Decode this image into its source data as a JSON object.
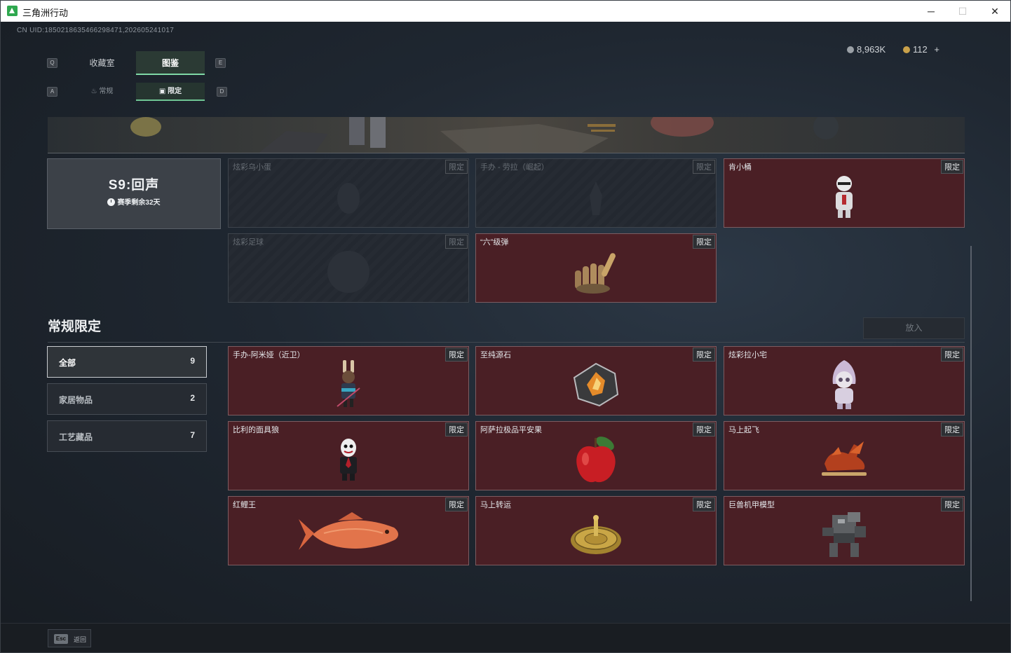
{
  "window": {
    "title": "三角洲行动",
    "min": "─",
    "max": "☐",
    "close": "✕"
  },
  "uid": "CN UID:1850218635466298471,202605241017",
  "keys": {
    "q": "Q",
    "e": "E",
    "a": "A",
    "d": "D"
  },
  "tabs": [
    {
      "label": "收藏室",
      "active": false
    },
    {
      "label": "图鉴",
      "active": true
    }
  ],
  "subtabs": [
    {
      "label": "常规",
      "active": false
    },
    {
      "label": "限定",
      "active": true
    }
  ],
  "currency": {
    "coins": "8,963K",
    "gold": "112",
    "add": "+"
  },
  "season": {
    "title": "S9:回声",
    "remaining": "赛季剩余32天"
  },
  "season_cards": [
    {
      "name": "炫彩乌小蛋",
      "tag": "限定",
      "owned": false
    },
    {
      "name": "手办 - 劳拉（崛起）",
      "tag": "限定",
      "owned": false
    },
    {
      "name": "肯小桶",
      "tag": "限定",
      "owned": true
    },
    {
      "name": "炫彩足球",
      "tag": "限定",
      "owned": false
    },
    {
      "name": "“六”级弹",
      "tag": "限定",
      "owned": true
    }
  ],
  "section": {
    "title": "常规限定",
    "put_in": "放入"
  },
  "filters": [
    {
      "label": "全部",
      "count": "9",
      "active": true
    },
    {
      "label": "家居物品",
      "count": "2",
      "active": false
    },
    {
      "label": "工艺藏品",
      "count": "7",
      "active": false
    }
  ],
  "items": [
    {
      "name": "手办-阿米娅（近卫）",
      "tag": "限定"
    },
    {
      "name": "至纯源石",
      "tag": "限定"
    },
    {
      "name": "炫彩拉小宅",
      "tag": "限定"
    },
    {
      "name": "比利的面具狼",
      "tag": "限定"
    },
    {
      "name": "阿萨拉极品平安果",
      "tag": "限定"
    },
    {
      "name": "马上起飞",
      "tag": "限定"
    },
    {
      "name": "红鲤王",
      "tag": "限定"
    },
    {
      "name": "马上转运",
      "tag": "限定"
    },
    {
      "name": "巨兽机甲模型",
      "tag": "限定"
    }
  ],
  "footer": {
    "key": "Esc",
    "label": "返回"
  }
}
